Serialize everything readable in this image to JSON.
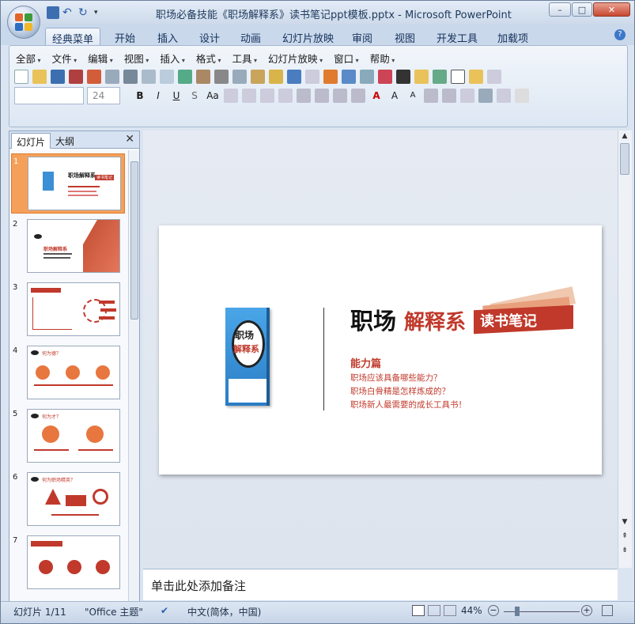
{
  "window": {
    "title": "职场必备技能《职场解释系》读书笔记ppt模板.pptx - Microsoft PowerPoint",
    "controls": [
      "–",
      "□",
      "✕"
    ]
  },
  "ribbon_tabs": [
    "经典菜单",
    "开始",
    "插入",
    "设计",
    "动画",
    "幻灯片放映",
    "审阅",
    "视图",
    "开发工具",
    "加载项"
  ],
  "active_tab": "经典菜单",
  "menus": [
    "全部",
    "文件",
    "编辑",
    "视图",
    "插入",
    "格式",
    "工具",
    "幻灯片放映",
    "窗口",
    "帮助"
  ],
  "font_size_combo": "24",
  "left_pane": {
    "tabs": [
      "幻灯片",
      "大纲"
    ],
    "active": "幻灯片",
    "close": "✕",
    "slides": [
      {
        "num": "1",
        "title": "职场解释系",
        "sub": "读书笔记"
      },
      {
        "num": "2",
        "title": "职场解释系",
        "sub": ""
      },
      {
        "num": "3",
        "title": "",
        "sub": ""
      },
      {
        "num": "4",
        "title": "何为德？",
        "sub": ""
      },
      {
        "num": "5",
        "title": "何为才？",
        "sub": ""
      },
      {
        "num": "6",
        "title": "何为职场精英？",
        "sub": ""
      },
      {
        "num": "7",
        "title": "",
        "sub": ""
      }
    ]
  },
  "slide": {
    "title_black": "职场",
    "title_red": "解释系",
    "banner": "读书笔记",
    "section": "能力篇",
    "items": [
      "职场应该具备哪些能力？",
      "职场白骨精是怎样炼成的？",
      "职场新人最需要的成长工具书！"
    ],
    "book_title_top": "职场",
    "book_title_bottom": "解释系"
  },
  "notes_placeholder": "单击此处添加备注",
  "status": {
    "slide_indicator": "幻灯片 1/11",
    "theme": "\"Office 主题\"",
    "language": "中文(简体，中国)",
    "zoom": "44%"
  },
  "colors": {
    "accent": "#c0392b",
    "orange": "#d9532b",
    "selection": "#f5a05a"
  }
}
